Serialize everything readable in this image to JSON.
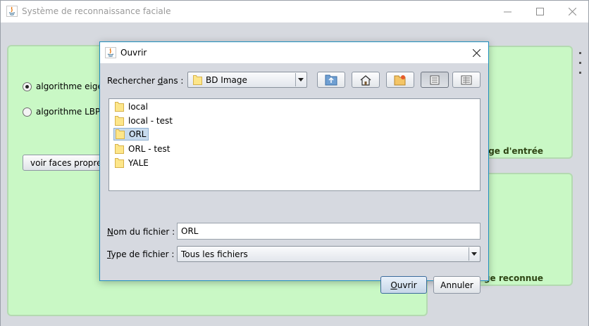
{
  "main_window": {
    "title": "Système de reconnaissance faciale",
    "left_panel": {
      "radio_eigen": "algorithme eigen",
      "radio_lbp": "algorithme LBP",
      "eigenfaces_button": "voir faces propres",
      "selected": "eigen"
    },
    "right_panels": {
      "input_caption": "age d'entrée",
      "recognized_caption": "age reconnue"
    },
    "colors": {
      "panel_green": "#c9f8c5",
      "caption_text": "#2e4514"
    }
  },
  "dialog": {
    "title": "Ouvrir",
    "lookin_label_pre": "Rechercher ",
    "lookin_label_mnemonic": "d",
    "lookin_label_post": "ans :",
    "lookin_value": "BD Image",
    "toolbar": [
      {
        "name": "up-one-level-icon"
      },
      {
        "name": "home-icon"
      },
      {
        "name": "new-folder-icon"
      },
      {
        "name": "list-view-icon",
        "pressed": true
      },
      {
        "name": "details-view-icon"
      }
    ],
    "files": [
      {
        "label": "local",
        "selected": false
      },
      {
        "label": "local - test",
        "selected": false
      },
      {
        "label": "ORL",
        "selected": true
      },
      {
        "label": "ORL - test",
        "selected": false
      },
      {
        "label": "YALE",
        "selected": false
      }
    ],
    "filename_label_mnemonic": "N",
    "filename_label_rest": "om du fichier :",
    "filename_value": "ORL",
    "filetype_label_mnemonic": "T",
    "filetype_label_rest": "ype de fichier :",
    "filetype_value": "Tous les fichiers",
    "open_label_mnemonic": "O",
    "open_label_rest": "uvrir",
    "cancel_label": "Annuler"
  }
}
